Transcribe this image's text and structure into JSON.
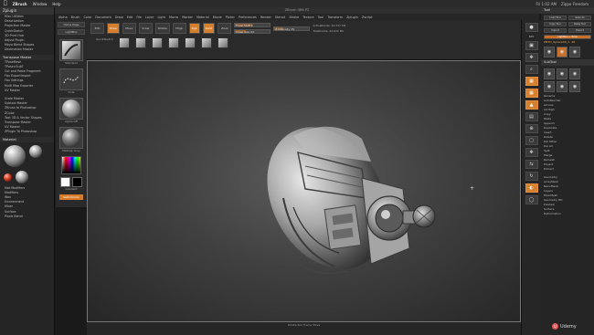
{
  "mac_menu": {
    "app": "ZBrush",
    "items": [
      "Window",
      "Help"
    ],
    "time": "Fri 1:02 AM",
    "user": "Zippo Freedom"
  },
  "zbrush_title": "ZBrush 4R6 P2",
  "menubar": [
    "Alpha",
    "Brush",
    "Color",
    "Document",
    "Draw",
    "Edit",
    "File",
    "Layer",
    "Light",
    "Macro",
    "Marker",
    "Material",
    "Movie",
    "Picker",
    "Preferences",
    "Render",
    "Stencil",
    "Stroke",
    "Texture",
    "Tool",
    "Transform",
    "Zplugin",
    "Zscript"
  ],
  "left_panel": {
    "title": "Zplugin",
    "items_top": [
      "Misc Utilities",
      "Deactivation",
      "Projection Master",
      "QuickSketch",
      "3D Print Hub",
      "Adjust Plugin",
      "Maya Blend Shapes",
      "Decimation Master"
    ],
    "section": "Transpose Master",
    "items_mid": [
      "TPoseMesh",
      "TPose>SubT",
      "Cut and Paste Fragment",
      "Fbx ExportImport",
      "Fbx Settings",
      "Multi Map Exporter",
      "UV Master"
    ],
    "items_low": [
      "Scale Master",
      "Subtool Master",
      "ZBrush to Photoshop",
      "ZColor",
      "Text 3D & Vector Shapes",
      "Transpose Master",
      "UV Master",
      "ZPlugin To Photoshop"
    ],
    "material_title": "Material",
    "items_bottom": [
      "Mat Modifiers",
      "Modifiers",
      "Wax",
      "Environment",
      "Mixer",
      "Surface",
      "Pixols Blend"
    ]
  },
  "tool_col": {
    "buttons": [
      "Home Page",
      "LightBox"
    ],
    "brush": "Standard",
    "stroke": "Dots",
    "alpha": "Alpha Off",
    "texture": "Texture Off",
    "material": "MatCap Gray",
    "gradient": "Gradient",
    "switch": "SwitchColor"
  },
  "shelf": {
    "buttons": [
      "Edit",
      "Draw",
      "Move",
      "Scale",
      "Rotate"
    ],
    "rgb": "Rgb",
    "zadd": "Zadd",
    "zsub": "Zsub",
    "mrgb": "Mrgb",
    "focal_label": "Focal Shift 0",
    "draw_label": "Draw Size 64",
    "intensity_label": "Z Intensity 25",
    "active_points": "ActivePoints: 10,727 Mil",
    "total_points": "TotalPoints: 24.932 Mil",
    "quick_sketch": "QuickSketch"
  },
  "viewport_status": "Rotate Roll Frame Move",
  "right_dock_labels": [
    "BPR",
    "SPix 3",
    "Scroll",
    "Zoom",
    "Actual",
    "AAHalf",
    "Persp",
    "Floor",
    "Local",
    "Frame",
    "Move",
    "Scale",
    "Rotate",
    "Transp",
    "Solo"
  ],
  "right_panel": {
    "title": "Tool",
    "rows": [
      "Load Tool",
      "Save As",
      "Copy Tool",
      "Paste Tool",
      "Import",
      "Export",
      "Clone",
      "Make PolyMesh3D",
      "GoZ",
      "All",
      "Visible",
      "R"
    ],
    "lightbox_tools": "Lightbox > Tools",
    "tool_name": "PM3D_Sphere3D_1. 48",
    "subtool_head": "SubTool",
    "list": [
      "Rename",
      "AutoReorder",
      "All Low",
      "All High",
      "Copy",
      "Paste",
      "Append",
      "Duplicate",
      "Insert",
      "Delete",
      "Del Other",
      "Del All",
      "Split",
      "Merge",
      "Remesh",
      "Project",
      "Extract"
    ],
    "bottom_list": [
      "Geometry",
      "ArrayMesh",
      "NanoMesh",
      "Layers",
      "FiberMesh",
      "Geometry HD",
      "Preview",
      "Surface",
      "Deformation"
    ]
  },
  "watermark": "Udemy"
}
